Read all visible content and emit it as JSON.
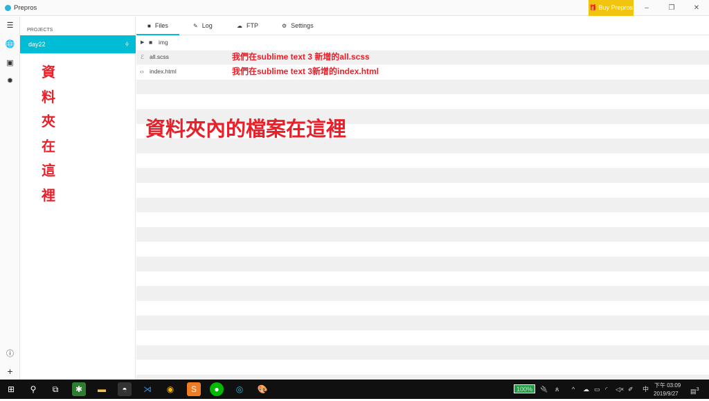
{
  "window": {
    "title": "Prepros",
    "buy_label": "Buy Prepros",
    "minimize": "–",
    "maximize": "❐",
    "close": "✕"
  },
  "sidebar": {
    "header": "PROJECTS",
    "project": "day22",
    "note": "資料夾在這裡"
  },
  "tabs": [
    {
      "label": "Files",
      "icon": "folder-icon"
    },
    {
      "label": "Log",
      "icon": "pen-icon"
    },
    {
      "label": "FTP",
      "icon": "cloud-upload-icon"
    },
    {
      "label": "Settings",
      "icon": "gear-icon"
    }
  ],
  "files": [
    {
      "name": "img",
      "type": "folder",
      "note": ""
    },
    {
      "name": "all.scss",
      "type": "scss",
      "note": "我們在sublime text 3 新增的all.scss"
    },
    {
      "name": "index.html",
      "type": "html",
      "note": "我們在sublime text 3新增的index.html"
    }
  ],
  "annotation": "資料夾內的檔案在這裡",
  "taskbar": {
    "battery": "100%",
    "ime": "中",
    "time": "下午 03:09",
    "date": "2019/9/27",
    "notifications": "3"
  }
}
